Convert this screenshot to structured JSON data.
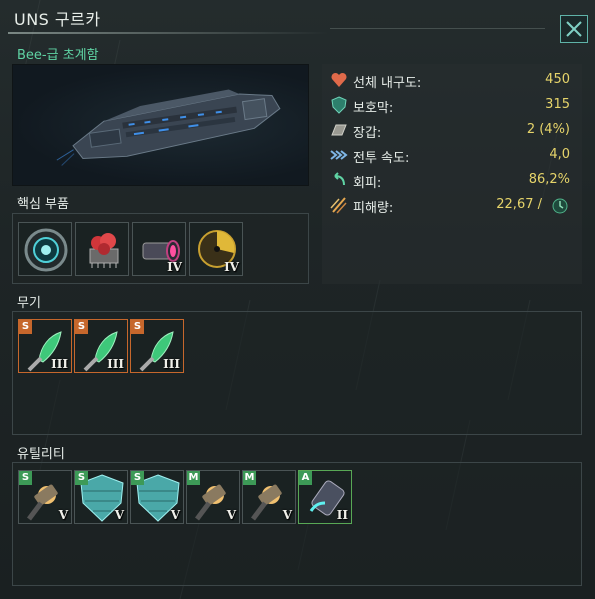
{
  "window": {
    "title": "UNS 구르카",
    "ship_class": "Bee-급 초계함"
  },
  "stats": [
    {
      "label": "선체 내구도:",
      "value": "450",
      "icon": "heart-icon",
      "color": "#e06a4a"
    },
    {
      "label": "보호막:",
      "value": "315",
      "icon": "shield-icon",
      "color": "#4fb39a"
    },
    {
      "label": "장갑:",
      "value": "2 (4%)",
      "icon": "armor-icon",
      "color": "#b8b8b0"
    },
    {
      "label": "전투 속도:",
      "value": "4,0",
      "icon": "speed-icon",
      "color": "#7fb6e6"
    },
    {
      "label": "회피:",
      "value": "86,2%",
      "icon": "evasion-icon",
      "color": "#5fd3a4"
    },
    {
      "label": "피해량:",
      "value": "22,67 /",
      "icon": "damage-icon",
      "color": "#e6a850"
    }
  ],
  "core": {
    "label": "핵심 부품",
    "slots": [
      {
        "icon": "reactor-icon",
        "tier": ""
      },
      {
        "icon": "computer-icon",
        "tier": ""
      },
      {
        "icon": "thruster-icon",
        "tier": "IV"
      },
      {
        "icon": "sensor-icon",
        "tier": "IV"
      }
    ]
  },
  "weapons": {
    "label": "무기",
    "slots": [
      {
        "size": "S",
        "tier": "III",
        "icon": "energy-weapon-icon"
      },
      {
        "size": "S",
        "tier": "III",
        "icon": "energy-weapon-icon"
      },
      {
        "size": "S",
        "tier": "III",
        "icon": "energy-weapon-icon"
      }
    ]
  },
  "utilities": {
    "label": "유틸리티",
    "slots": [
      {
        "size": "S",
        "tier": "V",
        "icon": "armor-plate-icon"
      },
      {
        "size": "S",
        "tier": "V",
        "icon": "deflector-icon"
      },
      {
        "size": "S",
        "tier": "V",
        "icon": "deflector-icon"
      },
      {
        "size": "M",
        "tier": "V",
        "icon": "armor-plate-icon"
      },
      {
        "size": "M",
        "tier": "V",
        "icon": "armor-plate-icon"
      },
      {
        "size": "A",
        "tier": "II",
        "icon": "aux-module-icon"
      }
    ]
  },
  "colors": {
    "accent": "#5fb3a8",
    "value": "#e6d46a",
    "weapon_slot": "#c6672c",
    "aux_slot": "#58a855"
  }
}
